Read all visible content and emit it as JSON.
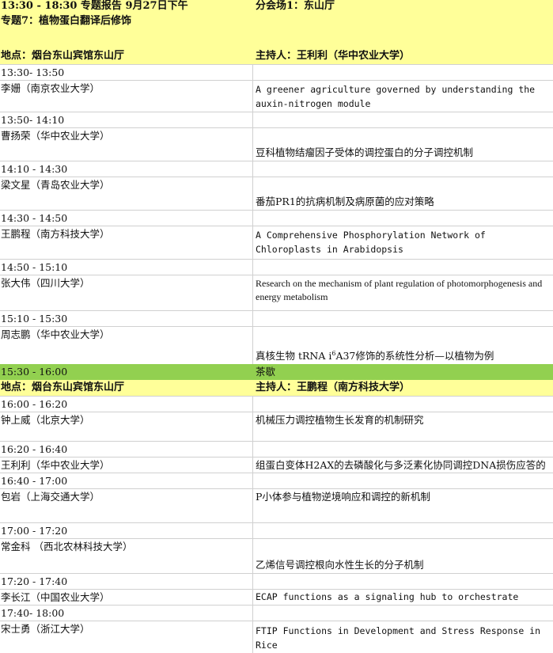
{
  "header": {
    "line1_left": "13:30 - 18:30 专题报告 9月27日下午",
    "line1_right": "分会场1：东山厅",
    "line2_left": "专题7：植物蛋白翻译后修饰"
  },
  "session1": {
    "location": "地点：烟台东山宾馆东山厅",
    "host": "主持人：王利利（华中农业大学）"
  },
  "talks1": [
    {
      "time": "13:30- 13:50",
      "speaker": "李姗（南京农业大学）",
      "title": "A greener agriculture governed by understanding the auxin-nitrogen module"
    },
    {
      "time": "13:50- 14:10",
      "speaker": "曹扬荣（华中农业大学）",
      "title": "豆科植物结瘤因子受体的调控蛋白的分子调控机制"
    },
    {
      "time": "14:10 - 14:30",
      "speaker": "梁文星（青岛农业大学）",
      "title": "番茄PR1的抗病机制及病原菌的应对策略"
    },
    {
      "time": "14:30 - 14:50",
      "speaker": "王鹏程（南方科技大学）",
      "title": "A Comprehensive Phosphorylation Network of Chloroplasts in Arabidopsis"
    },
    {
      "time": "14:50 - 15:10",
      "speaker": "张大伟（四川大学）",
      "title": "Research on the mechanism of plant regulation of photomorphogenesis and energy metabolism"
    },
    {
      "time": "15:10 - 15:30",
      "speaker": "周志鹏（华中农业大学）",
      "title_pre": "真核生物 tRNA i",
      "title_sup": "6",
      "title_post": "A37修饰的系统性分析—以植物为例"
    }
  ],
  "break": {
    "time": "15:30 - 16:00",
    "label": "茶歇"
  },
  "session2": {
    "location": "地点：烟台东山宾馆东山厅",
    "host": "主持人：王鹏程（南方科技大学）"
  },
  "talks2": [
    {
      "time": "16:00 - 16:20",
      "speaker": "钟上威（北京大学）",
      "title": "机械压力调控植物生长发育的机制研究"
    },
    {
      "time": "16:20 - 16:40",
      "speaker": "王利利（华中农业大学）",
      "title": "组蛋白变体H2AX的去磷酸化与多泛素化协同调控DNA损伤应答的"
    },
    {
      "time": "16:40 - 17:00",
      "speaker": "包岩（上海交通大学）",
      "title": "P小体参与植物逆境响应和调控的新机制"
    },
    {
      "time": "17:00 - 17:20",
      "speaker": "常金科 （西北农林科技大学）",
      "title": "乙烯信号调控根向水性生长的分子机制"
    },
    {
      "time": "17:20 - 17:40",
      "speaker": "李长江（中国农业大学）",
      "title": "ECAP functions as a signaling hub to orchestrate"
    },
    {
      "time": "17:40- 18:00",
      "speaker": "宋士勇（浙江大学）",
      "title": "FTIP Functions in Development and Stress Response in Rice"
    }
  ],
  "colors": {
    "header_fill": "#ffff99",
    "break_fill": "#92d050",
    "grid": "#d0d0d0"
  }
}
